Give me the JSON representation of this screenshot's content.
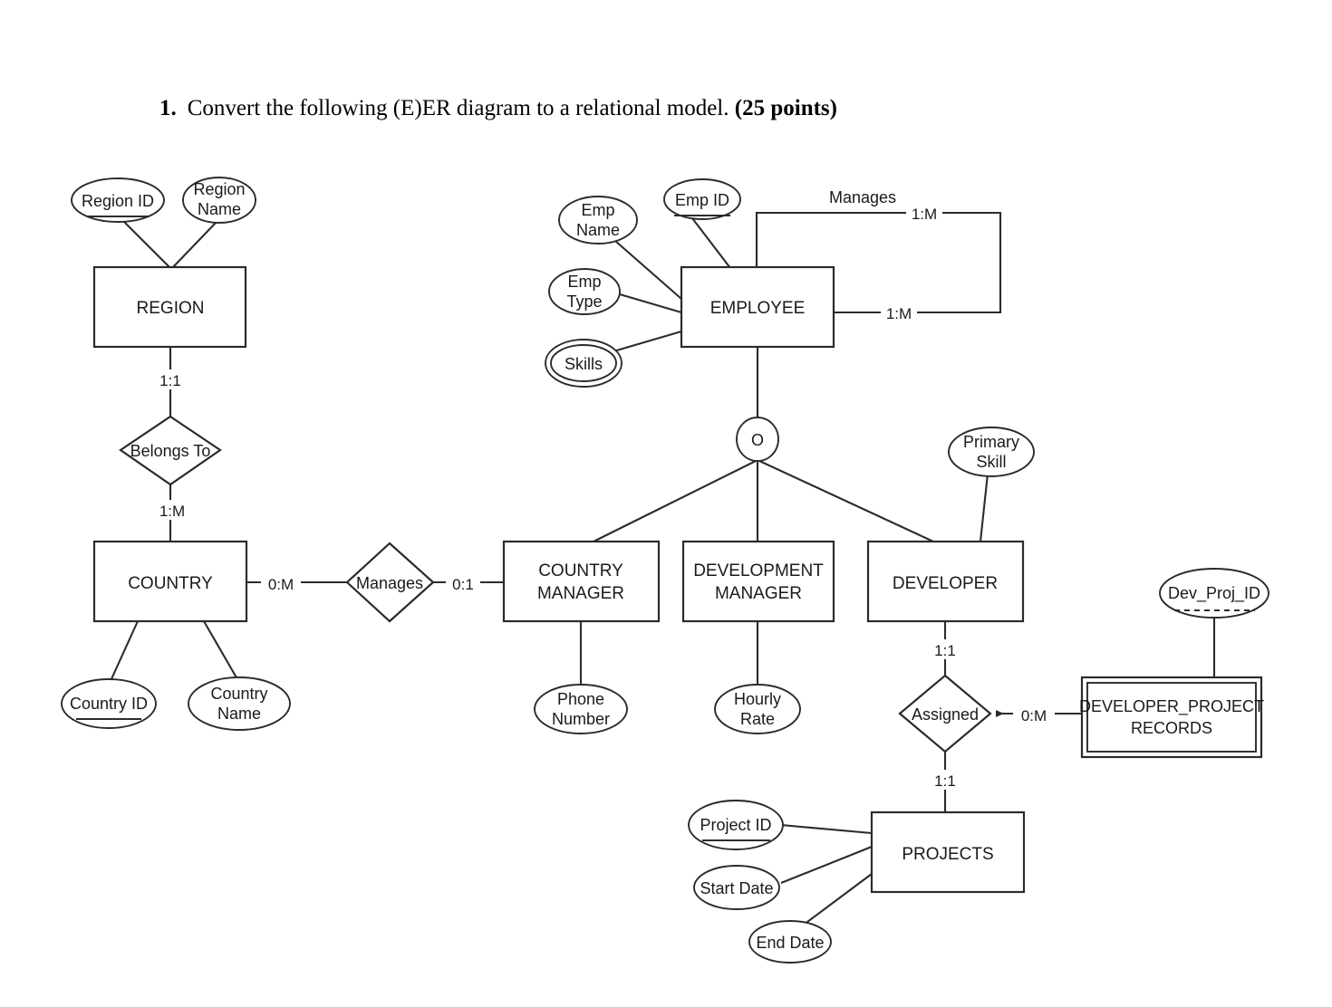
{
  "question": {
    "number": "1.",
    "text": "Convert the following (E)ER diagram to a relational model.",
    "points": "(25 points)"
  },
  "diagram": {
    "type": "ER diagram",
    "entities": [
      {
        "id": "region",
        "label": "REGION",
        "kind": "strong"
      },
      {
        "id": "country",
        "label": "COUNTRY",
        "kind": "strong"
      },
      {
        "id": "employee",
        "label": "EMPLOYEE",
        "kind": "strong"
      },
      {
        "id": "country_manager",
        "label_line1": "COUNTRY",
        "label_line2": "MANAGER",
        "kind": "subclass"
      },
      {
        "id": "development_manager",
        "label_line1": "DEVELOPMENT",
        "label_line2": "MANAGER",
        "kind": "subclass"
      },
      {
        "id": "developer",
        "label": "DEVELOPER",
        "kind": "subclass"
      },
      {
        "id": "dev_proj_records",
        "label_line1": "DEVELOPER_PROJECT",
        "label_line2": "RECORDS",
        "kind": "weak"
      },
      {
        "id": "projects",
        "label": "PROJECTS",
        "kind": "strong"
      }
    ],
    "attributes": [
      {
        "id": "region_id",
        "label": "Region ID",
        "kind": "key",
        "owner": "region"
      },
      {
        "id": "region_name",
        "label_line1": "Region",
        "label_line2": "Name",
        "kind": "simple",
        "owner": "region"
      },
      {
        "id": "country_id",
        "label": "Country ID",
        "kind": "key",
        "owner": "country"
      },
      {
        "id": "country_name",
        "label_line1": "Country",
        "label_line2": "Name",
        "kind": "simple",
        "owner": "country"
      },
      {
        "id": "emp_id",
        "label": "Emp ID",
        "kind": "key",
        "owner": "employee"
      },
      {
        "id": "emp_name",
        "label_line1": "Emp",
        "label_line2": "Name",
        "kind": "simple",
        "owner": "employee"
      },
      {
        "id": "emp_type",
        "label_line1": "Emp",
        "label_line2": "Type",
        "kind": "simple",
        "owner": "employee"
      },
      {
        "id": "skills",
        "label": "Skills",
        "kind": "multivalued",
        "owner": "employee"
      },
      {
        "id": "phone_number",
        "label_line1": "Phone",
        "label_line2": "Number",
        "kind": "simple",
        "owner": "country_manager"
      },
      {
        "id": "hourly_rate",
        "label_line1": "Hourly",
        "label_line2": "Rate",
        "kind": "simple",
        "owner": "development_manager"
      },
      {
        "id": "primary_skill",
        "label_line1": "Primary",
        "label_line2": "Skill",
        "kind": "simple",
        "owner": "developer"
      },
      {
        "id": "dev_proj_id",
        "label": "Dev_Proj_ID",
        "kind": "partial-key",
        "owner": "dev_proj_records"
      },
      {
        "id": "project_id",
        "label": "Project ID",
        "kind": "key",
        "owner": "projects"
      },
      {
        "id": "start_date",
        "label": "Start Date",
        "kind": "simple",
        "owner": "projects"
      },
      {
        "id": "end_date",
        "label": "End Date",
        "kind": "simple",
        "owner": "projects"
      }
    ],
    "relationships": [
      {
        "id": "belongs_to",
        "label": "Belongs To",
        "kind": "diamond"
      },
      {
        "id": "manages_country",
        "label": "Manages",
        "kind": "diamond"
      },
      {
        "id": "manages_employee",
        "label": "Manages",
        "kind": "line-label"
      },
      {
        "id": "assigned",
        "label": "Assigned",
        "kind": "diamond"
      }
    ],
    "cardinalities": {
      "region_belongs_to": "1:1",
      "belongs_to_country": "1:M",
      "country_manages": "0:M",
      "manages_country_manager": "0:1",
      "employee_manages_top": "1:M",
      "employee_manages_bottom": "1:M",
      "developer_assigned": "1:1",
      "assigned_projects": "1:1",
      "records_assigned": "0:M"
    },
    "specialization": {
      "id": "overlapping",
      "symbol": "O",
      "meaning": "overlapping specialization",
      "superclass": "EMPLOYEE",
      "subclasses": [
        "COUNTRY MANAGER",
        "DEVELOPMENT MANAGER",
        "DEVELOPER"
      ]
    },
    "colors": {
      "stroke": "#2b2b2b",
      "fill": "#ffffff",
      "text": "#1a1a1a",
      "background": "#ffffff"
    }
  }
}
